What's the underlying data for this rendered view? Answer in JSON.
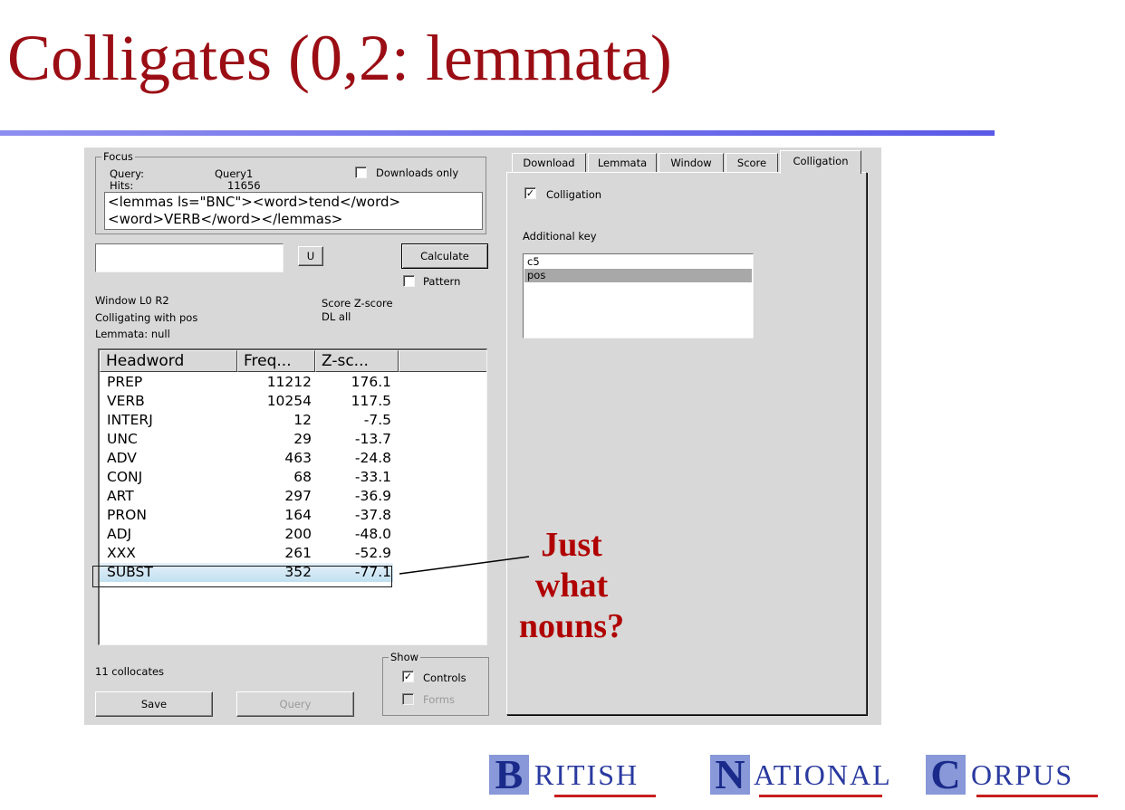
{
  "slide": {
    "title": "Colligates (0,2: lemmata)",
    "annotation": [
      "Just",
      "what",
      "nouns?"
    ]
  },
  "focus": {
    "legend": "Focus",
    "query_label": "Query:",
    "query_value": "Query1",
    "hits_label": "Hits:",
    "hits_value": "11656",
    "downloads_only_label": "Downloads only",
    "downloads_only_checked": false,
    "query_text": "<lemmas ls=\"BNC\"><word>tend</word><word>VERB</word></lemmas>"
  },
  "controls": {
    "search_value": "",
    "u_button": "U",
    "calculate_button": "Calculate",
    "pattern_label": "Pattern",
    "pattern_checked": false
  },
  "info": {
    "window": "Window L0 R2",
    "colligating": "Colligating with pos",
    "lemmata": "Lemmata: null",
    "score": "Score Z-score",
    "dl": "DL all"
  },
  "table": {
    "columns": [
      "Headword",
      "Freq...",
      "Z-sc..."
    ],
    "rows": [
      {
        "headword": "PREP",
        "freq": "11212",
        "z": "176.1"
      },
      {
        "headword": "VERB",
        "freq": "10254",
        "z": "117.5"
      },
      {
        "headword": "INTERJ",
        "freq": "12",
        "z": "-7.5"
      },
      {
        "headword": "UNC",
        "freq": "29",
        "z": "-13.7"
      },
      {
        "headword": "ADV",
        "freq": "463",
        "z": "-24.8"
      },
      {
        "headword": "CONJ",
        "freq": "68",
        "z": "-33.1"
      },
      {
        "headword": "ART",
        "freq": "297",
        "z": "-36.9"
      },
      {
        "headword": "PRON",
        "freq": "164",
        "z": "-37.8"
      },
      {
        "headword": "ADJ",
        "freq": "200",
        "z": "-48.0"
      },
      {
        "headword": "XXX",
        "freq": "261",
        "z": "-52.9"
      },
      {
        "headword": "SUBST",
        "freq": "352",
        "z": "-77.1"
      }
    ],
    "selected_row": "SUBST"
  },
  "footer": {
    "collocates": "11 collocates",
    "save_button": "Save",
    "query_button": "Query",
    "show_legend": "Show",
    "controls_label": "Controls",
    "controls_checked": true,
    "forms_label": "Forms",
    "forms_checked": false
  },
  "tabs": {
    "items": [
      "Download",
      "Lemmata",
      "Window",
      "Score",
      "Colligation"
    ],
    "active": "Colligation"
  },
  "colligation": {
    "checkbox_label": "Colligation",
    "checked": true,
    "additional_key_label": "Additional key",
    "keys": [
      "c5",
      "pos"
    ],
    "selected_key": "pos"
  },
  "logo": {
    "letters": [
      "B",
      "N",
      "C"
    ],
    "rest": [
      "RITISH",
      "ATIONAL",
      "ORPUS"
    ]
  }
}
